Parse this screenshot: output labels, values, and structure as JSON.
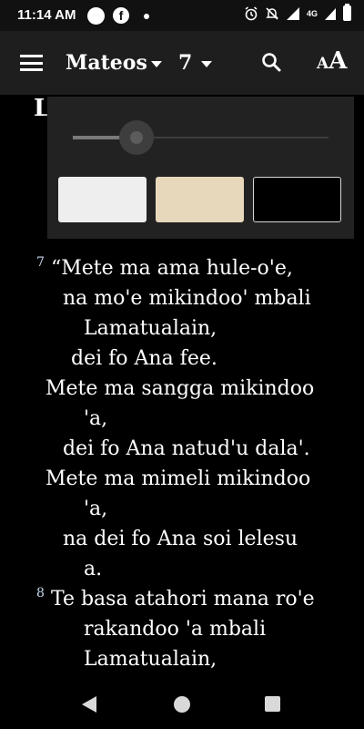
{
  "status_bar": {
    "time": "11:14 AM",
    "network": "4G",
    "icons": [
      "status-circle-icon",
      "facebook-icon",
      "dot-icon",
      "alarm-icon",
      "mute-icon",
      "signal-icon",
      "battery-icon"
    ]
  },
  "app_bar": {
    "book": "Mateos",
    "chapter": "7",
    "text_size_small": "A",
    "text_size_big": "A",
    "icons": [
      "menu-icon",
      "search-icon",
      "text-size-icon"
    ]
  },
  "peek_heading": "L",
  "display_settings": {
    "brightness_level": 0.25,
    "themes": [
      {
        "name": "light",
        "color": "#eeeeee"
      },
      {
        "name": "sepia",
        "color": "#e8d8bb"
      },
      {
        "name": "dark",
        "color": "#000000"
      }
    ]
  },
  "reader": {
    "verses": [
      {
        "number": "7",
        "lines": [
          "“Mete ma ama hule-o'e,",
          "na mo'e mikindoo' mbali",
          "Lamatualain,",
          "dei fo Ana fee.",
          "Mete ma sangga mikindoo",
          "'a,",
          "dei fo Ana natud'u dala'.",
          "Mete ma mimeli mikindoo",
          "'a,",
          "na dei fo Ana soi lelesu",
          "a."
        ]
      },
      {
        "number": "8",
        "lines": [
          "Te basa atahori mana ro'e",
          "rakandoo 'a mbali",
          "Lamatualain,"
        ]
      }
    ]
  },
  "nav_bar": {
    "icons": [
      "back-icon",
      "home-icon",
      "recents-icon"
    ]
  },
  "colors": {
    "app_bar": "#1e1e1e",
    "background": "#000000",
    "panel": "#222222",
    "verse_number": "#c8d8f0"
  }
}
